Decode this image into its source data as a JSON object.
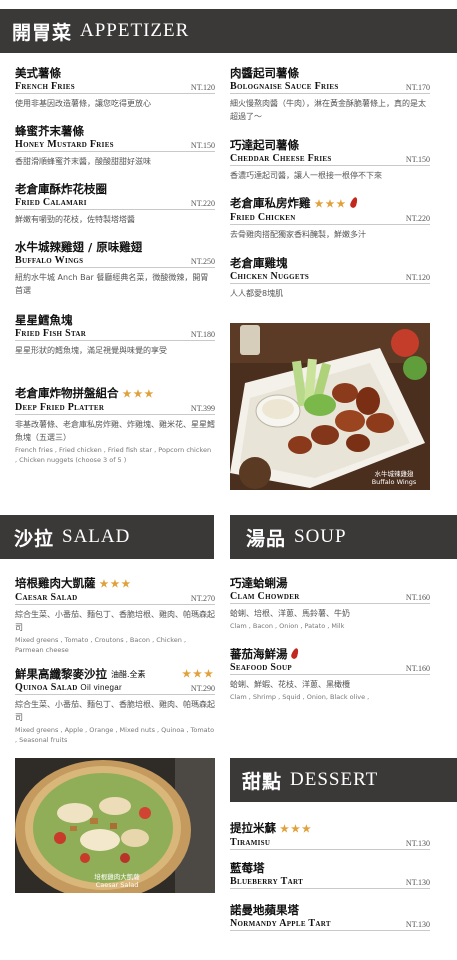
{
  "sections": {
    "appetizer": {
      "zh": "開胃菜",
      "en": "Appetizer"
    },
    "salad": {
      "zh": "沙拉",
      "en": "Salad"
    },
    "soup": {
      "zh": "湯品",
      "en": "Soup"
    },
    "dessert": {
      "zh": "甜點",
      "en": "Dessert"
    }
  },
  "appetizer_left": [
    {
      "zh": "美式薯條",
      "en": "French Fries",
      "price": "NT.120",
      "desc": "使用非基因改造薯條，讓您吃得更放心"
    },
    {
      "zh": "蜂蜜芥末薯條",
      "en": "Honey Mustard Fries",
      "price": "NT.150",
      "desc": "香甜滑順蜂蜜芥末醬，酸酸甜甜好滋味"
    },
    {
      "zh": "老倉庫酥炸花枝圈",
      "en": "Fried Calamari",
      "price": "NT.220",
      "desc": "鮮嫩有嚼勁的花枝，佐特製塔塔醬"
    },
    {
      "zh": "水牛城辣雞翅 / 原味雞翅",
      "en": "Buffalo Wings",
      "price": "NT.250",
      "desc": "紐約水牛城 Anch Bar 餐廳經典名菜，微酸微辣，開胃首選"
    },
    {
      "zh": "星星鱈魚塊",
      "en": "Fried Fish Star",
      "price": "NT.180",
      "desc": "星星形狀的鱈魚塊，滿足視覺與味覺的享受"
    },
    {
      "zh": "老倉庫炸物拼盤組合",
      "en": "Deep Fried Platter",
      "price": "NT.399",
      "stars": "★★★",
      "desc": "非基改薯條、老倉庫私房炸雞、炸雞塊、雞米花、星星鱈魚塊（五選三）",
      "desc_en": "French fries , Fried chicken , Fried fish star , Popcorn chicken , Chicken nuggets  (choose 3 of 5 )"
    }
  ],
  "appetizer_right": [
    {
      "zh": "肉醬起司薯條",
      "en": "Bolognaise Sauce Fries",
      "price": "NT.170",
      "desc": "細火慢熬肉醬（牛肉），淋在黃金酥脆薯條上，真的是太超過了～"
    },
    {
      "zh": "巧達起司薯條",
      "en": "Cheddar Cheese Fries",
      "price": "NT.150",
      "desc": "香濃巧達起司醬，讓人一根接一根停不下來"
    },
    {
      "zh": "老倉庫私房炸雞",
      "en": "Fried Chicken",
      "price": "NT.220",
      "stars": "★★★",
      "pepper": "chili-pepper-icon",
      "desc": "去骨雞肉搭配獨家香料醃製，鮮嫩多汁"
    },
    {
      "zh": "老倉庫雞塊",
      "en": "Chicken Nuggets",
      "price": "NT.120",
      "desc": "人人都愛8塊肌"
    }
  ],
  "salad": [
    {
      "zh": "培根雞肉大凱薩",
      "en": "Caesar Salad",
      "price": "NT.270",
      "stars": "★★★",
      "desc": "綜合生菜、小番茄、麵包丁、香脆培根、雞肉、帕瑪森起司",
      "desc_en": "Mixed greens , Tomato , Croutons , Bacon , Chicken , Parmean cheese"
    },
    {
      "zh": "鮮果高纖黎麥沙拉",
      "zh_note": "油醋.全素",
      "en": "Quinoa Salad",
      "en_note": "Oil vinegar",
      "price": "NT.290",
      "stars": "★★★",
      "desc": "綜合生菜、小番茄、麵包丁、香脆培根、雞肉、帕瑪森起司",
      "desc_en": "Mixed greens , Apple , Orange , Mixed nuts , Quinoa , Tomato , Seasonal fruits"
    }
  ],
  "soup": [
    {
      "zh": "巧達蛤蜊湯",
      "en": "Clam Chowder",
      "price": "NT.160",
      "desc": "蛤蜊、培根、洋蔥、馬鈴薯、牛奶",
      "desc_en": "Clam , Bacon , Onion , Patato , Milk"
    },
    {
      "zh": "蕃茄海鮮湯",
      "en": "Seafood Soup",
      "price": "NT.160",
      "pepper": "chili-pepper-icon",
      "desc": "蛤蜊、鮮蝦、花枝、洋蔥、黑橄欖",
      "desc_en": "Clam , Shrimp , Squid , Onion, Black olive ,"
    }
  ],
  "dessert": [
    {
      "zh": "提拉米蘇",
      "en": "Tiramisu",
      "price": "NT.130",
      "stars": "★★★"
    },
    {
      "zh": "藍莓塔",
      "en": "Blueberry Tart",
      "price": "NT.130"
    },
    {
      "zh": "諾曼地蘋果塔",
      "en": "Normandy Apple Tart",
      "price": "NT.130"
    }
  ],
  "photos": {
    "wings_caption_zh": "水牛城辣雞翅",
    "wings_caption_en": "Buffalo Wings",
    "salad_caption_zh": "培根雞肉大凱薩",
    "salad_caption_en": "Caesar Salad"
  },
  "colors": {
    "banner": "#3b3838",
    "star": "#e0a13a",
    "pepper": "#c2281e"
  }
}
